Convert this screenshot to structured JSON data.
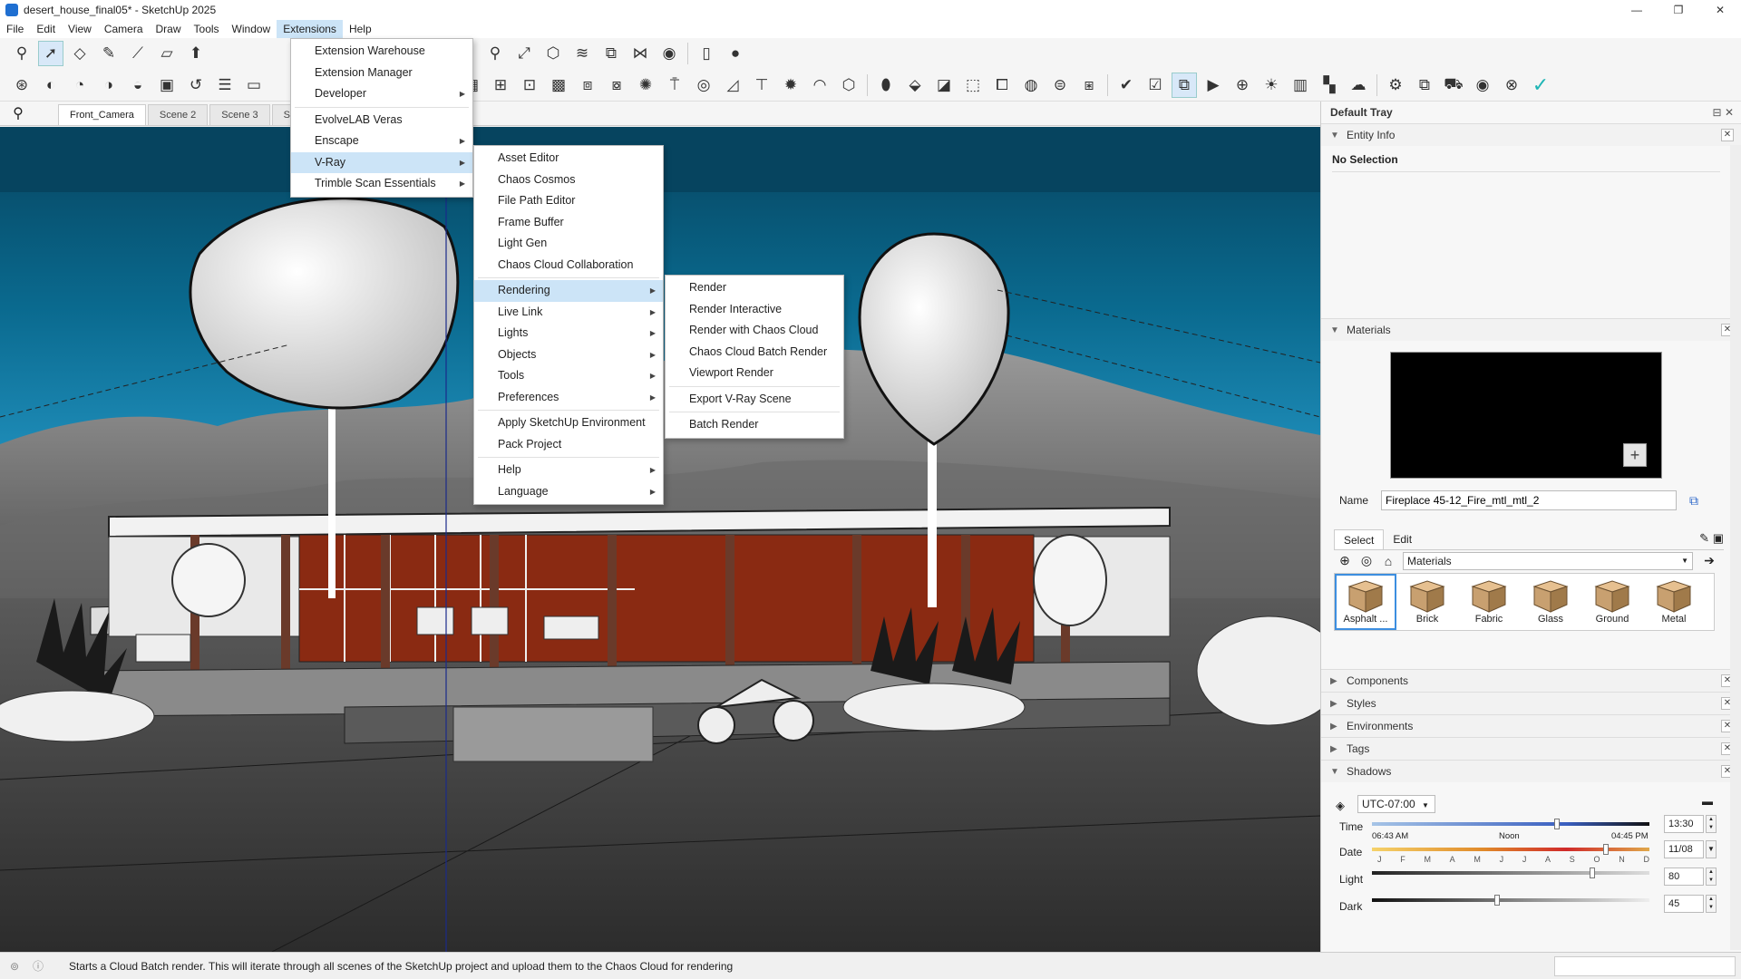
{
  "window": {
    "title": "desert_house_final05* - SketchUp 2025",
    "minimize": "—",
    "maximize": "❐",
    "close": "✕"
  },
  "menubar": [
    "File",
    "Edit",
    "View",
    "Camera",
    "Draw",
    "Tools",
    "Window",
    "Extensions",
    "Help"
  ],
  "scene_tabs": [
    "Front_Camera",
    "Scene 2",
    "Scene 3",
    "Scen"
  ],
  "extensions_menu": {
    "items": [
      {
        "label": "Extension Warehouse",
        "submenu": false
      },
      {
        "label": "Extension Manager",
        "submenu": false
      },
      {
        "label": "Developer",
        "submenu": true
      },
      {
        "label": "EvolveLAB Veras",
        "submenu": false
      },
      {
        "label": "Enscape",
        "submenu": true
      },
      {
        "label": "V-Ray",
        "submenu": true
      },
      {
        "label": "Trimble Scan Essentials",
        "submenu": true
      }
    ]
  },
  "vray_menu": {
    "items": [
      {
        "label": "Asset Editor",
        "submenu": false
      },
      {
        "label": "Chaos Cosmos",
        "submenu": false
      },
      {
        "label": "File Path Editor",
        "submenu": false
      },
      {
        "label": "Frame Buffer",
        "submenu": false
      },
      {
        "label": "Light Gen",
        "submenu": false
      },
      {
        "label": "Chaos Cloud Collaboration",
        "submenu": false
      },
      {
        "label": "Rendering",
        "submenu": true
      },
      {
        "label": "Live Link",
        "submenu": true
      },
      {
        "label": "Lights",
        "submenu": true
      },
      {
        "label": "Objects",
        "submenu": true
      },
      {
        "label": "Tools",
        "submenu": true
      },
      {
        "label": "Preferences",
        "submenu": true
      },
      {
        "label": "Apply SketchUp Environment",
        "submenu": false
      },
      {
        "label": "Pack Project",
        "submenu": false
      },
      {
        "label": "Help",
        "submenu": true
      },
      {
        "label": "Language",
        "submenu": true
      }
    ]
  },
  "rendering_menu": {
    "items": [
      "Render",
      "Render Interactive",
      "Render with Chaos Cloud",
      "Chaos Cloud Batch Render",
      "Viewport Render",
      "Export V-Ray Scene",
      "Batch Render"
    ]
  },
  "tray": {
    "title": "Default Tray",
    "entity_info": {
      "title": "Entity Info",
      "status": "No Selection"
    },
    "materials": {
      "title": "Materials",
      "name_label": "Name",
      "name_value": "Fireplace 45-12_Fire_mtl_mtl_2",
      "tabs": [
        "Select",
        "Edit"
      ],
      "library": "Materials",
      "swatches": [
        {
          "label": "Asphalt ...",
          "color": "#c8a070"
        },
        {
          "label": "Brick",
          "color": "#c8a070"
        },
        {
          "label": "Fabric",
          "color": "#c8a070"
        },
        {
          "label": "Glass",
          "color": "#c8a070"
        },
        {
          "label": "Ground",
          "color": "#c8a070"
        },
        {
          "label": "Metal",
          "color": "#c8a070"
        }
      ]
    },
    "collapsed_panels": [
      "Components",
      "Styles",
      "Environments",
      "Tags"
    ],
    "shadows": {
      "title": "Shadows",
      "timezone": "UTC-07:00",
      "time_label": "Time",
      "time_start": "06:43 AM",
      "time_noon": "Noon",
      "time_end": "04:45 PM",
      "time_value": "13:30",
      "date_label": "Date",
      "months": [
        "J",
        "F",
        "M",
        "A",
        "M",
        "J",
        "J",
        "A",
        "S",
        "O",
        "N",
        "D"
      ],
      "date_value": "11/08",
      "light_label": "Light",
      "light_value": "80",
      "dark_label": "Dark",
      "dark_value": "45",
      "time_position": 0.67,
      "date_position": 0.85,
      "light_level": 0.8,
      "dark_level": 0.45
    }
  },
  "status": {
    "message": "Starts a Cloud Batch render. This will iterate through all scenes of the SketchUp project and upload them to the Chaos Cloud for rendering"
  },
  "colors": {
    "menu_highlight": "#cce4f7",
    "sky": "#0d5c80",
    "wall_accent": "#8a2a12"
  }
}
